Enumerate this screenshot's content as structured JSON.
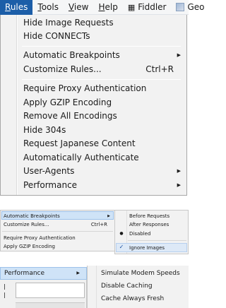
{
  "menubar": {
    "items": [
      {
        "label": "Rules",
        "underline": "R",
        "rest": "ules"
      },
      {
        "label": "Tools",
        "underline": "T",
        "rest": "ools"
      },
      {
        "label": "View",
        "underline": "V",
        "rest": "iew"
      },
      {
        "label": "Help",
        "underline": "H",
        "rest": "elp"
      },
      {
        "label": "Fiddler",
        "glyph": "#"
      },
      {
        "label": "Geo"
      }
    ]
  },
  "rules_menu": {
    "items": [
      "Hide Image Requests",
      "Hide CONNECTs",
      "Automatic Breakpoints",
      "Customize Rules...",
      "Require Proxy Authentication",
      "Apply GZIP Encoding",
      "Remove All Encodings",
      "Hide 304s",
      "Request Japanese Content",
      "Automatically Authenticate",
      "User-Agents",
      "Performance"
    ],
    "shortcut_customize": "Ctrl+R",
    "submenu_arrow": "▶"
  },
  "compact_menu": {
    "items": [
      "Automatic Breakpoints",
      "Customize Rules...",
      "Require Proxy Authentication",
      "Apply GZIP Encoding"
    ],
    "shortcut_customize": "Ctrl+R"
  },
  "breakpoints_submenu": {
    "items": [
      "Before Requests",
      "After Responses",
      "Disabled",
      "Ignore Images"
    ],
    "disabled_mark": "●",
    "ignore_mark": "✓"
  },
  "performance_panel": {
    "trigger": "Performance",
    "items": [
      "Simulate Modem Speeds",
      "Disable Caching",
      "Cache Always Fresh"
    ]
  },
  "colors": {
    "menu_highlight": "#1c5ea8",
    "hover": "#cfe3f7"
  }
}
